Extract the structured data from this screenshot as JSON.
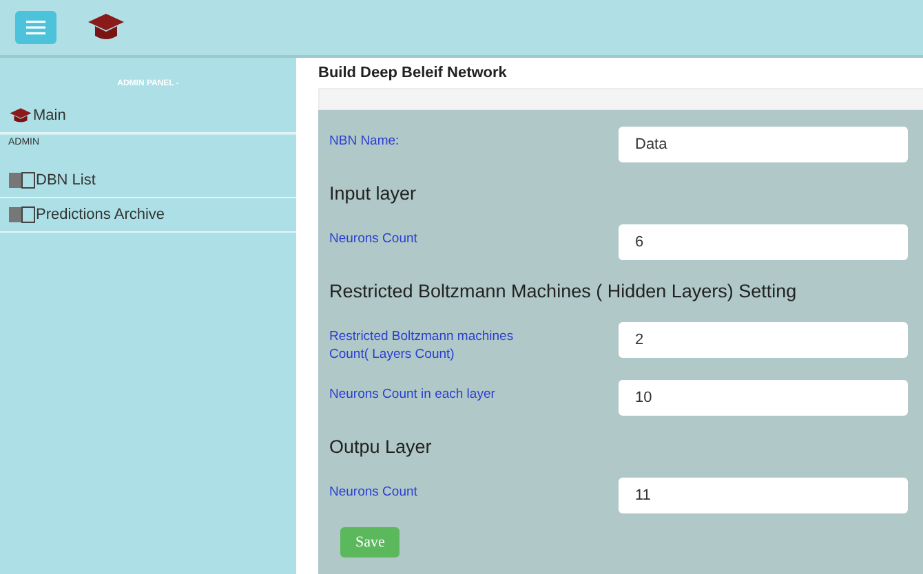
{
  "sidebar": {
    "title": "ADMIN PANEL -",
    "items": [
      {
        "kind": "home",
        "label": "Main"
      },
      {
        "kind": "section",
        "label": "ADMIN"
      },
      {
        "kind": "link",
        "label": "DBN List"
      },
      {
        "kind": "link",
        "label": "Predictions Archive"
      }
    ]
  },
  "page_title": "Build Deep Beleif Network",
  "form": [
    {
      "kind": "field",
      "label": "NBN Name:",
      "value": "Data"
    },
    {
      "kind": "heading",
      "label": "Input layer"
    },
    {
      "kind": "field",
      "label": "Neurons Count",
      "value": "6"
    },
    {
      "kind": "heading",
      "label": "Restricted Boltzmann Machines ( Hidden Layers) Setting"
    },
    {
      "kind": "field",
      "label": "Restricted Boltzmann machines Count( Layers Count)",
      "value": "2"
    },
    {
      "kind": "field",
      "label": "Neurons Count in each layer",
      "value": "10"
    },
    {
      "kind": "heading",
      "label": "Outpu Layer"
    },
    {
      "kind": "field",
      "label": "Neurons Count",
      "value": "11"
    }
  ],
  "save_button": "Save"
}
